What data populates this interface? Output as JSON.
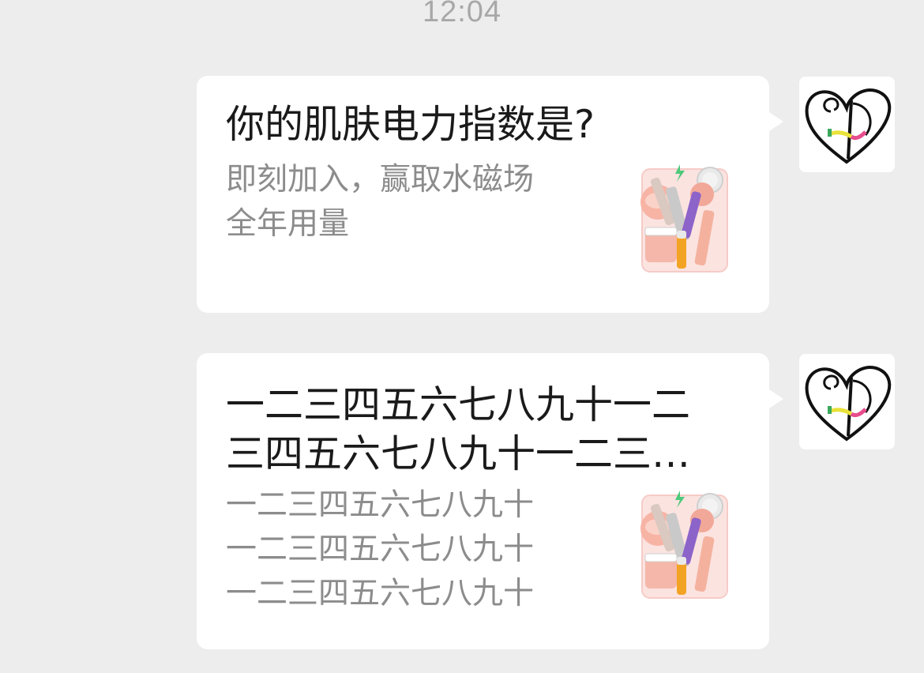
{
  "status": {
    "time": "12:04"
  },
  "messages": [
    {
      "title": "你的肌肤电力指数是?",
      "description": "即刻加入，赢取水磁场\n全年用量",
      "thumbnail_icon": "skincare-products-thumbnail",
      "avatar_icon": "heart-logo-avatar"
    },
    {
      "title": "一二三四五六七八九十一二\n三四五六七八九十一二三…",
      "description": "一二三四五六七八九十\n一二三四五六七八九十\n一二三四五六七八九十",
      "thumbnail_icon": "skincare-products-thumbnail",
      "avatar_icon": "heart-logo-avatar"
    }
  ],
  "colors": {
    "background": "#ededed",
    "card": "#ffffff",
    "title_text": "#1a1a1a",
    "desc_text": "#8c8c8c",
    "time_text": "#a8a8a8"
  }
}
